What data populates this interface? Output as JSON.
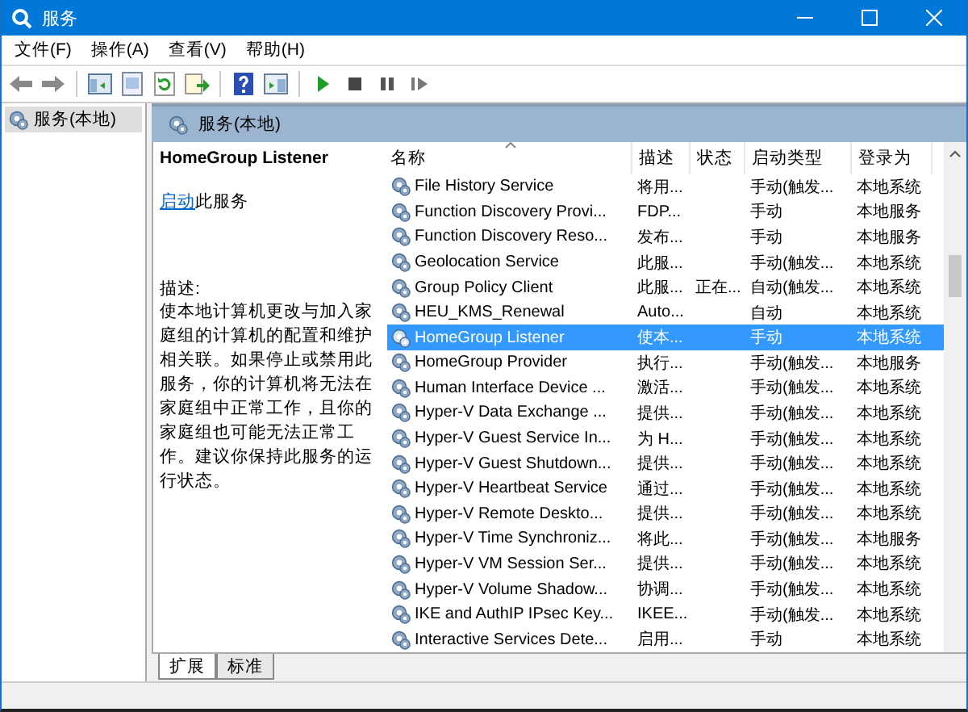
{
  "window": {
    "title": "服务"
  },
  "menu": [
    "文件(F)",
    "操作(A)",
    "查看(V)",
    "帮助(H)"
  ],
  "tree": {
    "items": [
      {
        "label": "服务(本地)",
        "selected": true
      }
    ]
  },
  "panel": {
    "title": "服务(本地)"
  },
  "details": {
    "service_name": "HomeGroup Listener",
    "action_link": "启动",
    "action_text": "此服务",
    "description_label": "描述:",
    "description": "使本地计算机更改与加入家庭组的计算机的配置和维护相关联。如果停止或禁用此服务，你的计算机将无法在家庭组中正常工作，且你的家庭组也可能无法正常工作。建议你保持此服务的运行状态。"
  },
  "table": {
    "columns": [
      {
        "label": "名称",
        "sorted": true
      },
      {
        "label": "描述",
        "sorted": false
      },
      {
        "label": "状态",
        "sorted": false
      },
      {
        "label": "启动类型",
        "sorted": false
      },
      {
        "label": "登录为",
        "sorted": false
      }
    ],
    "rows": [
      {
        "name": "File History Service",
        "description": "将用...",
        "status": "",
        "startup_type": "手动(触发...",
        "log_on_as": "本地系统",
        "selected": false
      },
      {
        "name": "Function Discovery Provi...",
        "description": "FDP...",
        "status": "",
        "startup_type": "手动",
        "log_on_as": "本地服务",
        "selected": false
      },
      {
        "name": "Function Discovery Reso...",
        "description": "发布...",
        "status": "",
        "startup_type": "手动",
        "log_on_as": "本地服务",
        "selected": false
      },
      {
        "name": "Geolocation Service",
        "description": "此服...",
        "status": "",
        "startup_type": "手动(触发...",
        "log_on_as": "本地系统",
        "selected": false
      },
      {
        "name": "Group Policy Client",
        "description": "此服...",
        "status": "正在...",
        "startup_type": "自动(触发...",
        "log_on_as": "本地系统",
        "selected": false
      },
      {
        "name": "HEU_KMS_Renewal",
        "description": "Auto...",
        "status": "",
        "startup_type": "自动",
        "log_on_as": "本地系统",
        "selected": false
      },
      {
        "name": "HomeGroup Listener",
        "description": "使本...",
        "status": "",
        "startup_type": "手动",
        "log_on_as": "本地系统",
        "selected": true
      },
      {
        "name": "HomeGroup Provider",
        "description": "执行...",
        "status": "",
        "startup_type": "手动(触发...",
        "log_on_as": "本地服务",
        "selected": false
      },
      {
        "name": "Human Interface Device ...",
        "description": "激活...",
        "status": "",
        "startup_type": "手动(触发...",
        "log_on_as": "本地系统",
        "selected": false
      },
      {
        "name": "Hyper-V Data Exchange ...",
        "description": "提供...",
        "status": "",
        "startup_type": "手动(触发...",
        "log_on_as": "本地系统",
        "selected": false
      },
      {
        "name": "Hyper-V Guest Service In...",
        "description": "为 H...",
        "status": "",
        "startup_type": "手动(触发...",
        "log_on_as": "本地系统",
        "selected": false
      },
      {
        "name": "Hyper-V Guest Shutdown...",
        "description": "提供...",
        "status": "",
        "startup_type": "手动(触发...",
        "log_on_as": "本地系统",
        "selected": false
      },
      {
        "name": "Hyper-V Heartbeat Service",
        "description": "通过...",
        "status": "",
        "startup_type": "手动(触发...",
        "log_on_as": "本地系统",
        "selected": false
      },
      {
        "name": "Hyper-V Remote Deskto...",
        "description": "提供...",
        "status": "",
        "startup_type": "手动(触发...",
        "log_on_as": "本地系统",
        "selected": false
      },
      {
        "name": "Hyper-V Time Synchroniz...",
        "description": "将此...",
        "status": "",
        "startup_type": "手动(触发...",
        "log_on_as": "本地服务",
        "selected": false
      },
      {
        "name": "Hyper-V VM Session Ser...",
        "description": "提供...",
        "status": "",
        "startup_type": "手动(触发...",
        "log_on_as": "本地系统",
        "selected": false
      },
      {
        "name": "Hyper-V Volume Shadow...",
        "description": "协调...",
        "status": "",
        "startup_type": "手动(触发...",
        "log_on_as": "本地系统",
        "selected": false
      },
      {
        "name": "IKE and AuthIP IPsec Key...",
        "description": "IKEE...",
        "status": "",
        "startup_type": "手动(触发...",
        "log_on_as": "本地系统",
        "selected": false
      },
      {
        "name": "Interactive Services Dete...",
        "description": "启用...",
        "status": "",
        "startup_type": "手动",
        "log_on_as": "本地系统",
        "selected": false
      }
    ]
  },
  "view_tabs": [
    {
      "label": "扩展",
      "selected": true
    },
    {
      "label": "标准",
      "selected": false
    }
  ]
}
